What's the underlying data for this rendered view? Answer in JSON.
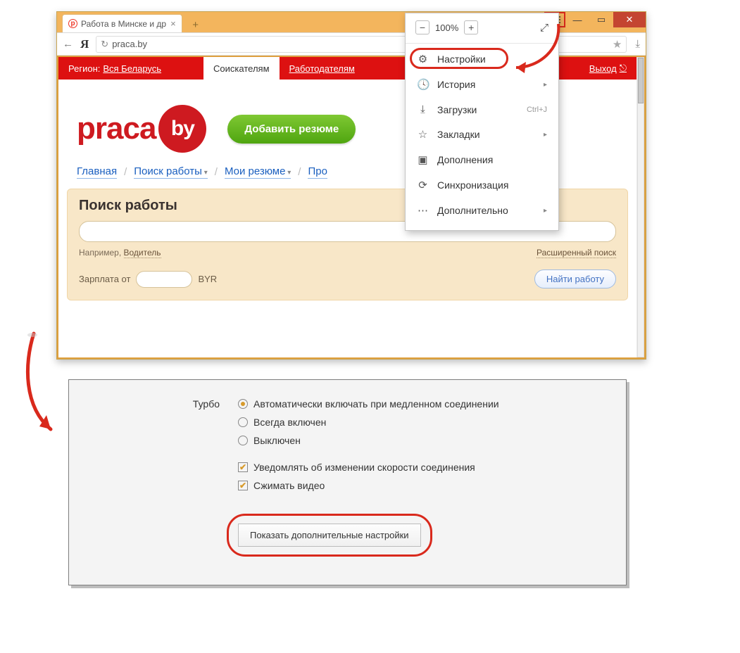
{
  "browser": {
    "tab_title": "Работа в Минске и др",
    "zoom_pct": "100%",
    "url": "praca.by"
  },
  "menu": {
    "settings": "Настройки",
    "history": "История",
    "downloads": "Загрузки",
    "downloads_hint": "Ctrl+J",
    "bookmarks": "Закладки",
    "addons": "Дополнения",
    "sync": "Синхронизация",
    "more": "Дополнительно"
  },
  "topnav": {
    "region_label": "Регион:",
    "region_value": "Вся Беларусь",
    "seekers": "Соискателям",
    "employers": "Работодателям",
    "exit": "Выход"
  },
  "hero": {
    "logo_p1": "praca",
    "logo_p2": "by",
    "add_resume": "Добавить резюме"
  },
  "crumbs": {
    "main": "Главная",
    "search": "Поиск работы",
    "resumes": "Мои резюме",
    "trunc": "Про"
  },
  "search": {
    "title": "Поиск работы",
    "example_label": "Например,",
    "example_link": "Водитель",
    "adv": "Расширенный поиск",
    "salary_label": "Зарплата от",
    "currency": "BYR",
    "find": "Найти работу"
  },
  "settings": {
    "turbo_label": "Турбо",
    "opt_auto": "Автоматически включать при медленном соединении",
    "opt_on": "Всегда включен",
    "opt_off": "Выключен",
    "chk_notify": "Уведомлять об изменении скорости соединения",
    "chk_compress": "Сжимать видео",
    "show_more": "Показать дополнительные настройки"
  }
}
